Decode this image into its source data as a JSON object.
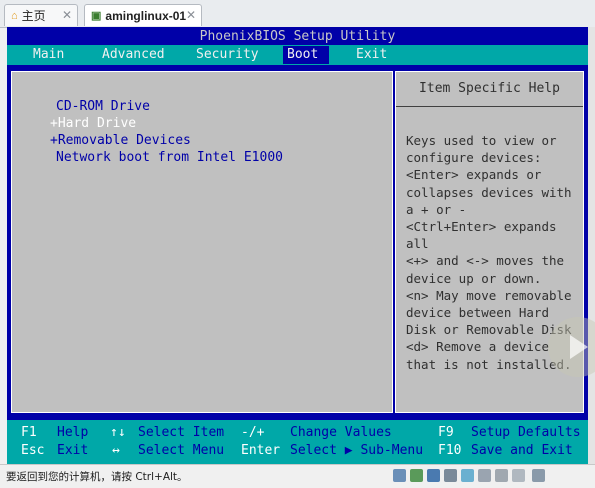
{
  "tabs": [
    {
      "label": "主页",
      "icon": "home-icon"
    },
    {
      "label": "aminglinux-01",
      "icon": "vm-icon"
    }
  ],
  "bios": {
    "title": "PhoenixBIOS Setup Utility",
    "menu": [
      "Main",
      "Advanced",
      "Security",
      "Boot",
      "Exit"
    ],
    "active_menu": "Boot",
    "boot_items": [
      "CD-ROM Drive",
      "+Hard Drive",
      "+Removable Devices",
      "Network boot from Intel E1000"
    ],
    "selected_item": "+Hard Drive",
    "help_title": "Item Specific Help",
    "help_lines": [
      "Keys used to view or",
      "configure devices:",
      "<Enter> expands or",
      "collapses devices with",
      "a + or -",
      "<Ctrl+Enter> expands",
      "all",
      "<+> and <-> moves the",
      "device up or down.",
      "<n> May move removable",
      "device between Hard",
      "Disk or Removable Disk",
      "<d> Remove a device",
      "that is not installed."
    ],
    "status_row1": {
      "k1": "F1",
      "t1": "Help",
      "k2": "↑↓",
      "t2": "Select Item",
      "k3": "-/+",
      "t3": "Change Values",
      "k4": "F9",
      "t4": "Setup Defaults"
    },
    "status_row2": {
      "k1": "Esc",
      "t1": "Exit",
      "k2": "↔",
      "t2": "Select Menu",
      "k3": "Enter",
      "t3": "Select ▶ Sub-Menu",
      "k4": "F10",
      "t4": "Save and Exit"
    }
  },
  "bottom_hint": "要返回到您的计算机，请按 Ctrl+Alt。",
  "colors": {
    "bios_blue": "#0000a8",
    "bios_cyan": "#00a8a8",
    "bios_gray": "#c0c0c0"
  }
}
